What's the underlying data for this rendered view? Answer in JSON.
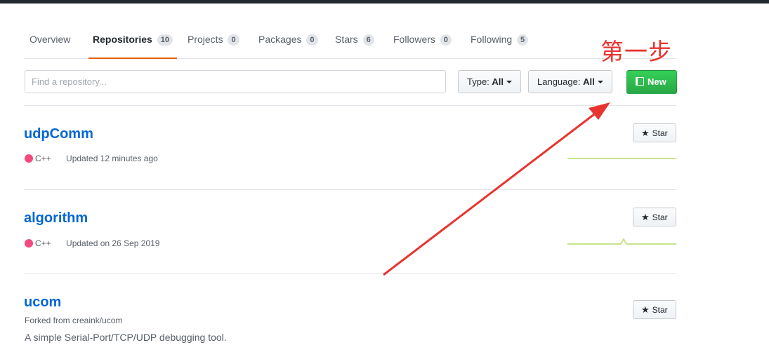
{
  "tabs": [
    {
      "label": "Overview",
      "count": null
    },
    {
      "label": "Repositories",
      "count": "10",
      "active": true
    },
    {
      "label": "Projects",
      "count": "0"
    },
    {
      "label": "Packages",
      "count": "0"
    },
    {
      "label": "Stars",
      "count": "6"
    },
    {
      "label": "Followers",
      "count": "0"
    },
    {
      "label": "Following",
      "count": "5"
    }
  ],
  "filters": {
    "search_placeholder": "Find a repository...",
    "type_label": "Type:",
    "type_value": "All",
    "language_label": "Language:",
    "language_value": "All",
    "new_label": "New"
  },
  "repos": [
    {
      "name": "udpComm",
      "language": "C++",
      "updated": "Updated 12 minutes ago",
      "star_label": "Star"
    },
    {
      "name": "algorithm",
      "language": "C++",
      "updated": "Updated on 26 Sep 2019",
      "star_label": "Star"
    },
    {
      "name": "ucom",
      "forked_from": "Forked from creaink/ucom",
      "description": "A simple Serial-Port/TCP/UDP debugging tool.",
      "star_label": "Star"
    }
  ],
  "colors": {
    "accent_tab": "#e36209",
    "link": "#0366d6",
    "cpp_dot": "#f34b7d",
    "new_button": "#28a745",
    "annotation": "#e8342f"
  },
  "icons": {
    "new_button": "book-icon",
    "star_button": "star-icon"
  },
  "annotation": {
    "text": "第一步"
  }
}
